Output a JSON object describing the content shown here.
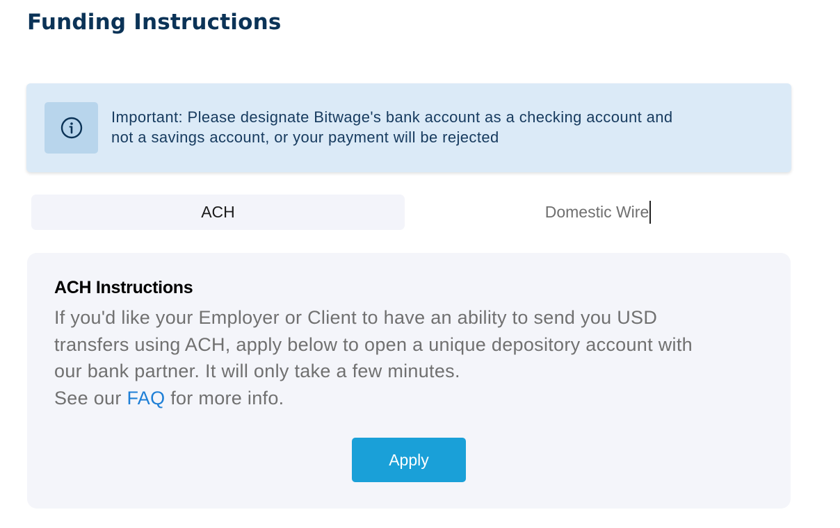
{
  "header": {
    "title": "Funding Instructions"
  },
  "alert": {
    "icon": "info-icon",
    "line1": "Important: Please designate Bitwage's bank account as a checking account and",
    "line2": "not a savings account, or your payment will be rejected"
  },
  "tabs": [
    {
      "label": "ACH",
      "active": true
    },
    {
      "label": "Domestic Wire",
      "active": false
    }
  ],
  "panel": {
    "heading": "ACH Instructions",
    "body_line1": "If you'd like your Employer or Client to have an ability to send you USD",
    "body_line2": "transfers using ACH, apply below to open a unique depository account with",
    "body_line3": "our bank partner. It will only take a few minutes.",
    "see_prefix": "See our ",
    "faq_link": "FAQ",
    "see_suffix": " for more info.",
    "apply_label": "Apply"
  },
  "colors": {
    "title": "#0b3357",
    "alert_bg": "#dbeaf7",
    "alert_icon_bg": "#b8d5ec",
    "link": "#1e7fd6",
    "button": "#1aa0d8",
    "panel_bg": "#f4f5fa"
  }
}
